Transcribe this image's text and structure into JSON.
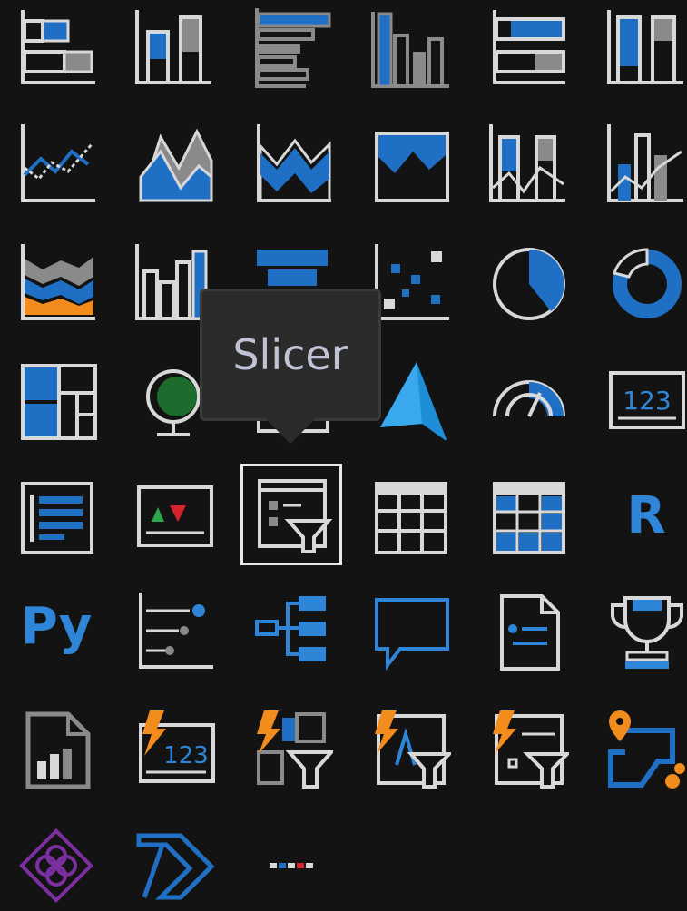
{
  "tooltip": {
    "text": "Slicer"
  },
  "tiles": {
    "r_visual_label": "R",
    "python_visual_label": "Py",
    "card_value": "123",
    "smart_narrative_card_value": "123"
  },
  "colors": {
    "background": "#131313",
    "icon_outline": "#d8d8d8",
    "accent_blue": "#1f6fc5",
    "accent_orange": "#f28c1c",
    "gray_fill": "#8a8a8a",
    "power_apps_purple": "#7b2fa0"
  },
  "icons": [
    "stacked-bar-chart-icon",
    "stacked-column-chart-icon",
    "clustered-bar-chart-icon",
    "clustered-column-chart-icon",
    "100-stacked-bar-chart-icon",
    "100-stacked-column-chart-icon",
    "line-chart-icon",
    "area-chart-icon",
    "stacked-area-chart-icon",
    "100-stacked-area-chart-icon",
    "line-and-stacked-column-chart-icon",
    "line-and-clustered-column-chart-icon",
    "ribbon-chart-icon",
    "waterfall-chart-icon",
    "funnel-icon",
    "scatter-chart-icon",
    "pie-chart-icon",
    "donut-chart-icon",
    "treemap-icon",
    "map-icon",
    "filled-map-icon",
    "azure-map-icon",
    "gauge-icon",
    "card-icon",
    "multi-row-card-icon",
    "kpi-icon",
    "slicer-icon",
    "table-icon",
    "matrix-icon",
    "r-script-visual-icon",
    "python-visual-icon",
    "key-influencers-icon",
    "decomposition-tree-icon",
    "qa-icon",
    "smart-narrative-icon",
    "goals-icon",
    "paginated-report-icon",
    "power-card-icon",
    "power-slicer-icon",
    "text-filter-icon",
    "attribute-slicer-icon",
    "arcgis-map-icon",
    "power-apps-icon",
    "power-automate-icon",
    "more-visuals-icon"
  ]
}
